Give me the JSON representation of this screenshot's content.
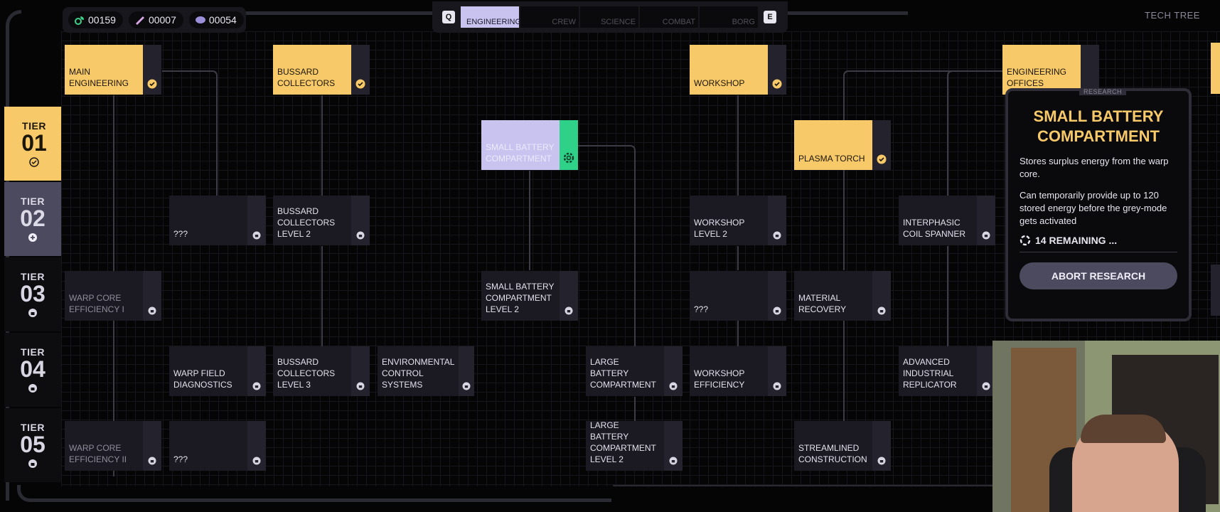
{
  "resources": [
    {
      "icon": "gear-leaf-icon",
      "value": "00159"
    },
    {
      "icon": "crystal-icon",
      "value": "00007"
    },
    {
      "icon": "brain-icon",
      "value": "00054"
    }
  ],
  "tabs": {
    "prev_key": "Q",
    "next_key": "E",
    "items": [
      {
        "label": "ENGINEERING",
        "active": true
      },
      {
        "label": "CREW",
        "active": false
      },
      {
        "label": "SCIENCE",
        "active": false
      },
      {
        "label": "COMBAT",
        "active": false
      },
      {
        "label": "BORG",
        "active": false
      }
    ]
  },
  "screen_label": "TECH TREE",
  "tiers": [
    {
      "label": "TIER",
      "number": "01",
      "state": "completed"
    },
    {
      "label": "TIER",
      "number": "02",
      "state": "current"
    },
    {
      "label": "TIER",
      "number": "03",
      "state": "locked"
    },
    {
      "label": "TIER",
      "number": "04",
      "state": "locked"
    },
    {
      "label": "TIER",
      "number": "05",
      "state": "locked"
    }
  ],
  "nodes": {
    "main_engineering": "MAIN ENGINEERING",
    "bussard_collectors": "BUSSARD COLLECTORS",
    "workshop": "WORKSHOP",
    "engineering_offices": "ENGINEERING OFFICES",
    "small_battery": "SMALL BATTERY COMPARTMENT",
    "plasma_torch": "PLASMA TORCH",
    "unknown_a": "???",
    "bussard_2": "BUSSARD COLLECTORS LEVEL 2",
    "workshop_2": "WORKSHOP LEVEL 2",
    "interphasic": "INTERPHASIC COIL SPANNER",
    "warp_core_1": "WARP CORE EFFICIENCY I",
    "small_battery_2": "SMALL BATTERY COMPARTMENT LEVEL 2",
    "unknown_b": "???",
    "material_recovery": "MATERIAL RECOVERY",
    "warp_field": "WARP FIELD DIAGNOSTICS",
    "bussard_3": "BUSSARD COLLECTORS LEVEL 3",
    "env_control": "ENVIRONMENTAL CONTROL SYSTEMS",
    "large_battery": "LARGE BATTERY COMPARTMENT",
    "workshop_eff": "WORKSHOP EFFICIENCY",
    "adv_replicator": "ADVANCED INDUSTRIAL REPLICATOR",
    "warp_core_2": "WARP CORE EFFICIENCY II",
    "unknown_c": "???",
    "large_battery_2": "LARGE BATTERY COMPARTMENT LEVEL 2",
    "streamlined": "STREAMLINED CONSTRUCTION"
  },
  "panel": {
    "tag": "RESEARCH",
    "title": "SMALL BATTERY COMPARTMENT",
    "desc1": "Stores surplus energy from the warp core.",
    "desc2": "Can temporarily provide up to 120 stored energy before the grey-mode gets activated",
    "remaining": "14 REMAINING ...",
    "abort": "ABORT RESEARCH"
  },
  "colors": {
    "completed": "#f8c968",
    "research": "#c8c4ef",
    "research_accent": "#2fd088",
    "node": "#1b1a22"
  }
}
